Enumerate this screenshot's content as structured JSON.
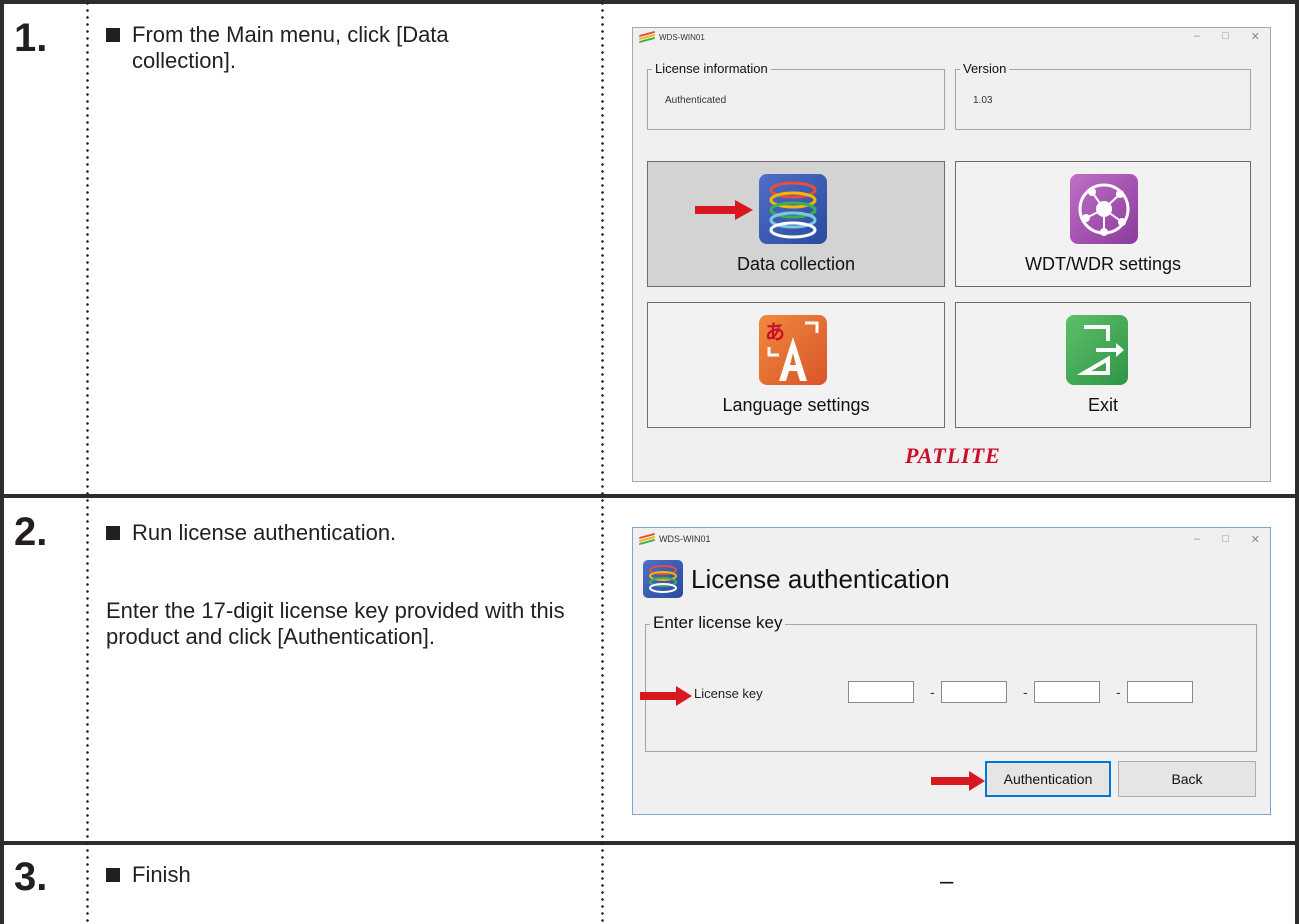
{
  "steps": [
    {
      "number": "1.",
      "bullet": "From the Main menu, click [Data collection].",
      "window": {
        "title": "WDS-WIN01",
        "controls": [
          "–",
          "□",
          "✕"
        ],
        "license_group": {
          "label": "License information",
          "value": "Authenticated"
        },
        "version_group": {
          "label": "Version",
          "value": "1.03"
        },
        "tiles": [
          {
            "label": "Data collection",
            "icon": "database-stack-icon",
            "selected": true
          },
          {
            "label": "WDT/WDR settings",
            "icon": "network-globe-icon",
            "selected": false
          },
          {
            "label": "Language settings",
            "icon": "language-a-icon",
            "selected": false
          },
          {
            "label": "Exit",
            "icon": "exit-door-icon",
            "selected": false
          }
        ],
        "brand": "PATLITE"
      }
    },
    {
      "number": "2.",
      "bullet": "Run license authentication.",
      "paragraph": "Enter the 17-digit license key provided with this product and click [Authentication].",
      "window": {
        "title": "WDS-WIN01",
        "controls": [
          "–",
          "□",
          "✕"
        ],
        "heading": "License authentication",
        "group_label": "Enter license key",
        "field_label": "License key",
        "separator": "-",
        "buttons": {
          "authenticate": "Authentication",
          "back": "Back"
        }
      }
    },
    {
      "number": "3.",
      "bullet": "Finish",
      "result": "–"
    }
  ],
  "colors": {
    "accent_red": "#d7191f",
    "rule": "#2d2d2d",
    "brand_red": "#c8102e"
  }
}
